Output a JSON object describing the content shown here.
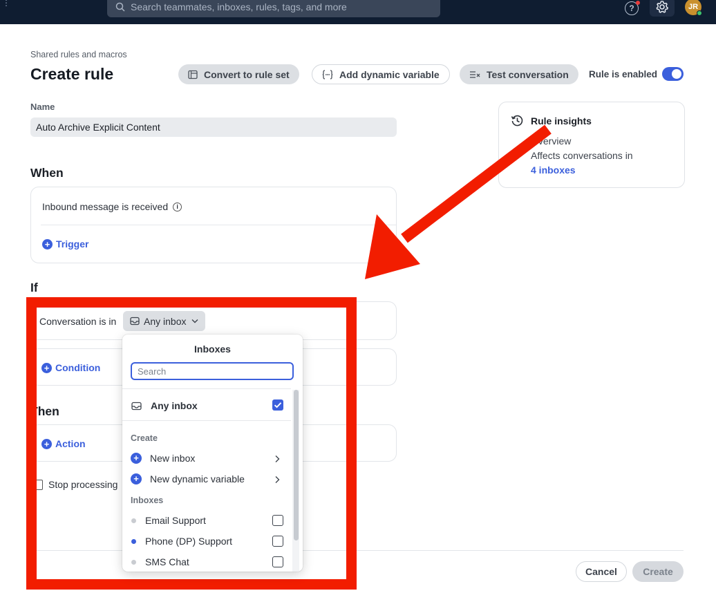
{
  "topbar": {
    "search_placeholder": "Search teammates, inboxes, rules, tags, and more",
    "avatar_initials": "JR"
  },
  "header": {
    "breadcrumb": "Shared rules and macros",
    "title": "Create rule",
    "convert_label": "Convert to rule set",
    "dynamic_label": "Add dynamic variable",
    "test_label": "Test conversation",
    "enabled_label": "Rule is enabled",
    "enabled": true
  },
  "form": {
    "name_label": "Name",
    "name_value": "Auto Archive Explicit Content"
  },
  "insights": {
    "title": "Rule insights",
    "overview": "Overview",
    "affects": "Affects conversations in",
    "link": "4 inboxes"
  },
  "when": {
    "heading": "When",
    "trigger_text": "Inbound message is received",
    "add_label": "Trigger"
  },
  "if": {
    "heading": "If",
    "condition_text": "Conversation is in",
    "chip_label": "Any inbox",
    "add_label": "Condition"
  },
  "then": {
    "heading": "Then",
    "add_label": "Action"
  },
  "stop_processing_label": "Stop processing",
  "footer": {
    "cancel_label": "Cancel",
    "create_label": "Create"
  },
  "dropdown": {
    "title": "Inboxes",
    "search_placeholder": "Search",
    "any_label": "Any inbox",
    "any_checked": true,
    "create_group": "Create",
    "create_items": [
      {
        "label": "New inbox"
      },
      {
        "label": "New dynamic variable"
      }
    ],
    "inbox_group": "Inboxes",
    "inboxes": [
      {
        "label": "Email Support",
        "color": "#c9ccd1",
        "checked": false
      },
      {
        "label": "Phone (DP) Support",
        "color": "#3b5fdc",
        "checked": false
      },
      {
        "label": "SMS Chat",
        "color": "#c9ccd1",
        "checked": false
      }
    ]
  },
  "annotation": {
    "highlight_color": "#f21d00",
    "arrow_color": "#f21d00"
  },
  "colors": {
    "accent": "#3b5fdc",
    "topbar": "#0f1d31"
  }
}
